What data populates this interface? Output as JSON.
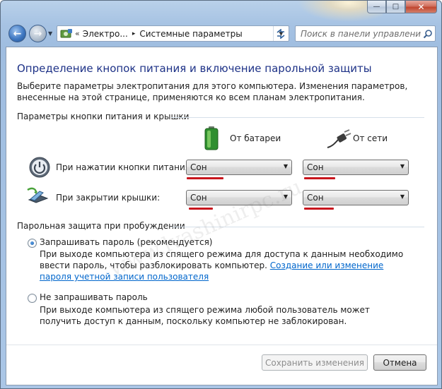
{
  "window": {
    "minimize_glyph": "—",
    "maximize_glyph": "□",
    "close_glyph": "✕"
  },
  "address_bar": {
    "overflow": "«",
    "crumbs": [
      "Электро...",
      "Системные параметры"
    ],
    "separator": "▸"
  },
  "search": {
    "placeholder": "Поиск в панели управления"
  },
  "page": {
    "title": "Определение кнопок питания и включение парольной защиты",
    "intro": "Выберите параметры электропитания для этого компьютера. Изменения параметров, внесенные на этой странице, применяются ко всем планам электропитания."
  },
  "power_buttons": {
    "section_title": "Параметры кнопки питания и крышки",
    "col_battery": "От батареи",
    "col_ac": "От сети",
    "rows": [
      {
        "label": "При нажатии кнопки питания:",
        "battery": "Сон",
        "ac": "Сон"
      },
      {
        "label": "При закрытии крышки:",
        "battery": "Сон",
        "ac": "Сон"
      }
    ]
  },
  "password": {
    "section_title": "Парольная защита при пробуждении",
    "options": [
      {
        "label": "Запрашивать пароль (рекомендуется)",
        "checked": true,
        "desc": "При выходе компьютера из спящего режима для доступа к данным необходимо ввести пароль, чтобы разблокировать компьютер.",
        "link": "Создание или изменение пароля учетной записи пользователя"
      },
      {
        "label": "Не запрашивать пароль",
        "checked": false,
        "desc": "При выходе компьютера из спящего режима любой пользователь может получить доступ к данным, поскольку компьютер не заблокирован."
      }
    ]
  },
  "buttons": {
    "save": "Сохранить изменения",
    "cancel": "Отмена"
  },
  "watermark": "www.lvashinirpc.ru",
  "colors": {
    "title": "#1e3287",
    "link": "#0066cc",
    "annotation_red": "#c8151d"
  }
}
